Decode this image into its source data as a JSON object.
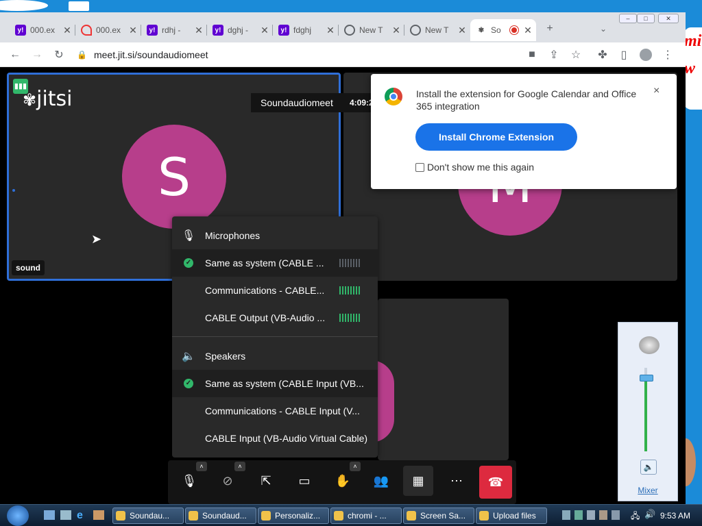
{
  "browser": {
    "tabs": [
      {
        "title": "000.ex",
        "favicon": "yahoo-icon",
        "color": "#6001d2"
      },
      {
        "title": "000.ex",
        "favicon": "swirl-icon",
        "color": "#e33"
      },
      {
        "title": "rdhj -",
        "favicon": "yahoo-icon",
        "color": "#6001d2"
      },
      {
        "title": "dghj -",
        "favicon": "yahoo-icon",
        "color": "#6001d2"
      },
      {
        "title": "fdghj",
        "favicon": "yahoo-icon",
        "color": "#6001d2"
      },
      {
        "title": "New T",
        "favicon": "globe-icon",
        "color": "#5f6368"
      },
      {
        "title": "New T",
        "favicon": "globe-icon",
        "color": "#5f6368"
      },
      {
        "title": "So",
        "favicon": "jitsi-icon",
        "color": "#5f6368"
      }
    ],
    "new_tab": "+",
    "url": "meet.jit.si/soundaudiomeet"
  },
  "meeting": {
    "logo": "jitsi",
    "name": "Soundaudiomeet",
    "timer": "4:09:2",
    "participant_s_initial": "S",
    "participant_s_name": "sound",
    "participant_m_initial": "M"
  },
  "extension_popup": {
    "message": "Install the extension for Google Calendar and Office 365 integration",
    "close": "×",
    "button": "Install Chrome Extension",
    "checkbox_label": "Don't show me this again"
  },
  "audio_menu": {
    "microphones_header": "Microphones",
    "microphones": [
      {
        "label": "Same as system (CABLE ...",
        "selected": true,
        "level": 0
      },
      {
        "label": "Communications - CABLE...",
        "selected": false,
        "level": 8
      },
      {
        "label": "CABLE Output (VB-Audio ...",
        "selected": false,
        "level": 8
      }
    ],
    "speakers_header": "Speakers",
    "speakers": [
      {
        "label": "Same as system (CABLE Input (VB...",
        "selected": true
      },
      {
        "label": "Communications - CABLE Input (V...",
        "selected": false
      },
      {
        "label": "CABLE Input (VB-Audio Virtual Cable)",
        "selected": false
      }
    ]
  },
  "volume_mixer": {
    "label": "Mixer",
    "level": 0.88
  },
  "taskbar": {
    "tasks": [
      "Soundau...",
      "Soundaud...",
      "Personaliz...",
      "chromi - ...",
      "Screen Sa...",
      "Upload files"
    ],
    "clock": "9:53 AM"
  },
  "colors": {
    "accent": "#1a73e8",
    "hangup": "#dd2a3f",
    "avatar": "#b73e8b",
    "level_on": "#31b76a"
  }
}
